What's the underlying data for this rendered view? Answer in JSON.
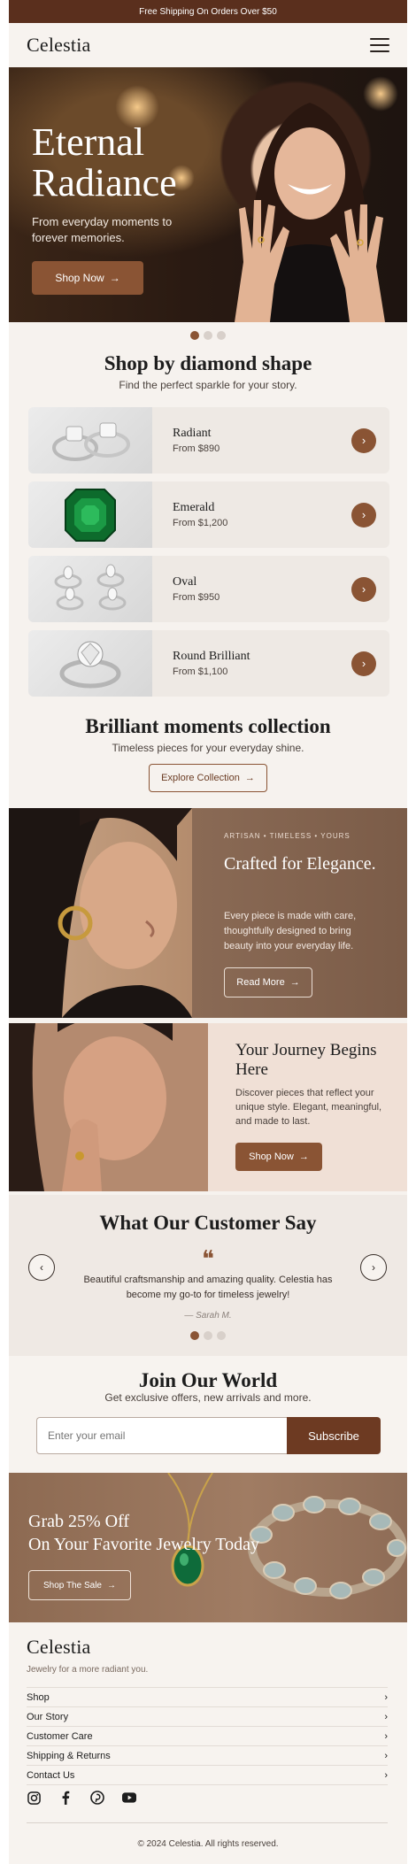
{
  "announcement": {
    "text": "Free Shipping On Orders Over $50"
  },
  "header": {
    "logo": "Celestia",
    "menu_icon": "hamburger-menu-icon"
  },
  "hero": {
    "title_line1": "Eternal",
    "title_line2": "Radiance",
    "subtitle": "From everyday moments to forever memories.",
    "cta_label": "Shop Now",
    "cta_icon": "arrow-right-icon",
    "slides_total": 3,
    "slide_active": 1
  },
  "shapes": {
    "title": "Shop by diamond shape",
    "subtitle": "Find the perfect sparkle for your story.",
    "items": [
      {
        "name": "Radiant",
        "price": "From $890"
      },
      {
        "name": "Emerald",
        "price": "From $1,200"
      },
      {
        "name": "Oval",
        "price": "From $950"
      },
      {
        "name": "Round Brilliant",
        "price": "From $1,100"
      }
    ]
  },
  "collection": {
    "title": "Brilliant moments collection",
    "subtitle": "Timeless pieces for your everyday shine.",
    "cta_label": "Explore Collection"
  },
  "crafted": {
    "eyebrow": "ARTISAN • TIMELESS • YOURS",
    "title": "Crafted for Elegance.",
    "body": "Every piece is made with care, thoughtfully designed to bring beauty into your everyday life.",
    "cta_label": "Read More"
  },
  "journey": {
    "title": "Your Journey Begins Here",
    "body": "Discover pieces that reflect your unique style. Elegant, meaningful, and made to last.",
    "cta_label": "Shop Now"
  },
  "testimonial": {
    "title": "What Our Customer Say",
    "quote_mark": "❝",
    "quote": "Beautiful craftsmanship and amazing quality. Celestia has become my go-to for timeless jewelry!",
    "author": "— Sarah M.",
    "slides_total": 3,
    "slide_active": 1
  },
  "newsletter": {
    "title": "Join Our World",
    "subtitle": "Get exclusive offers, new arrivals and more.",
    "placeholder": "Enter your email",
    "button_label": "Subscribe"
  },
  "sale": {
    "title_line1": "Grab 25% Off",
    "title_line2": "On Your Favorite Jewelry Today",
    "cta_label": "Shop The Sale"
  },
  "footer": {
    "logo": "Celestia",
    "tagline": "Jewelry for a more radiant you.",
    "links": [
      "Shop",
      "Our Story",
      "Customer Care",
      "Shipping & Returns",
      "Contact Us"
    ],
    "socials": [
      "instagram-icon",
      "facebook-icon",
      "pinterest-icon",
      "youtube-icon"
    ],
    "copyright": "© 2024 Celestia. All rights reserved."
  },
  "colors": {
    "brand_brown": "#8a5434",
    "dark_brown": "#5a2f1d",
    "page_bg": "#f6f2ee"
  }
}
